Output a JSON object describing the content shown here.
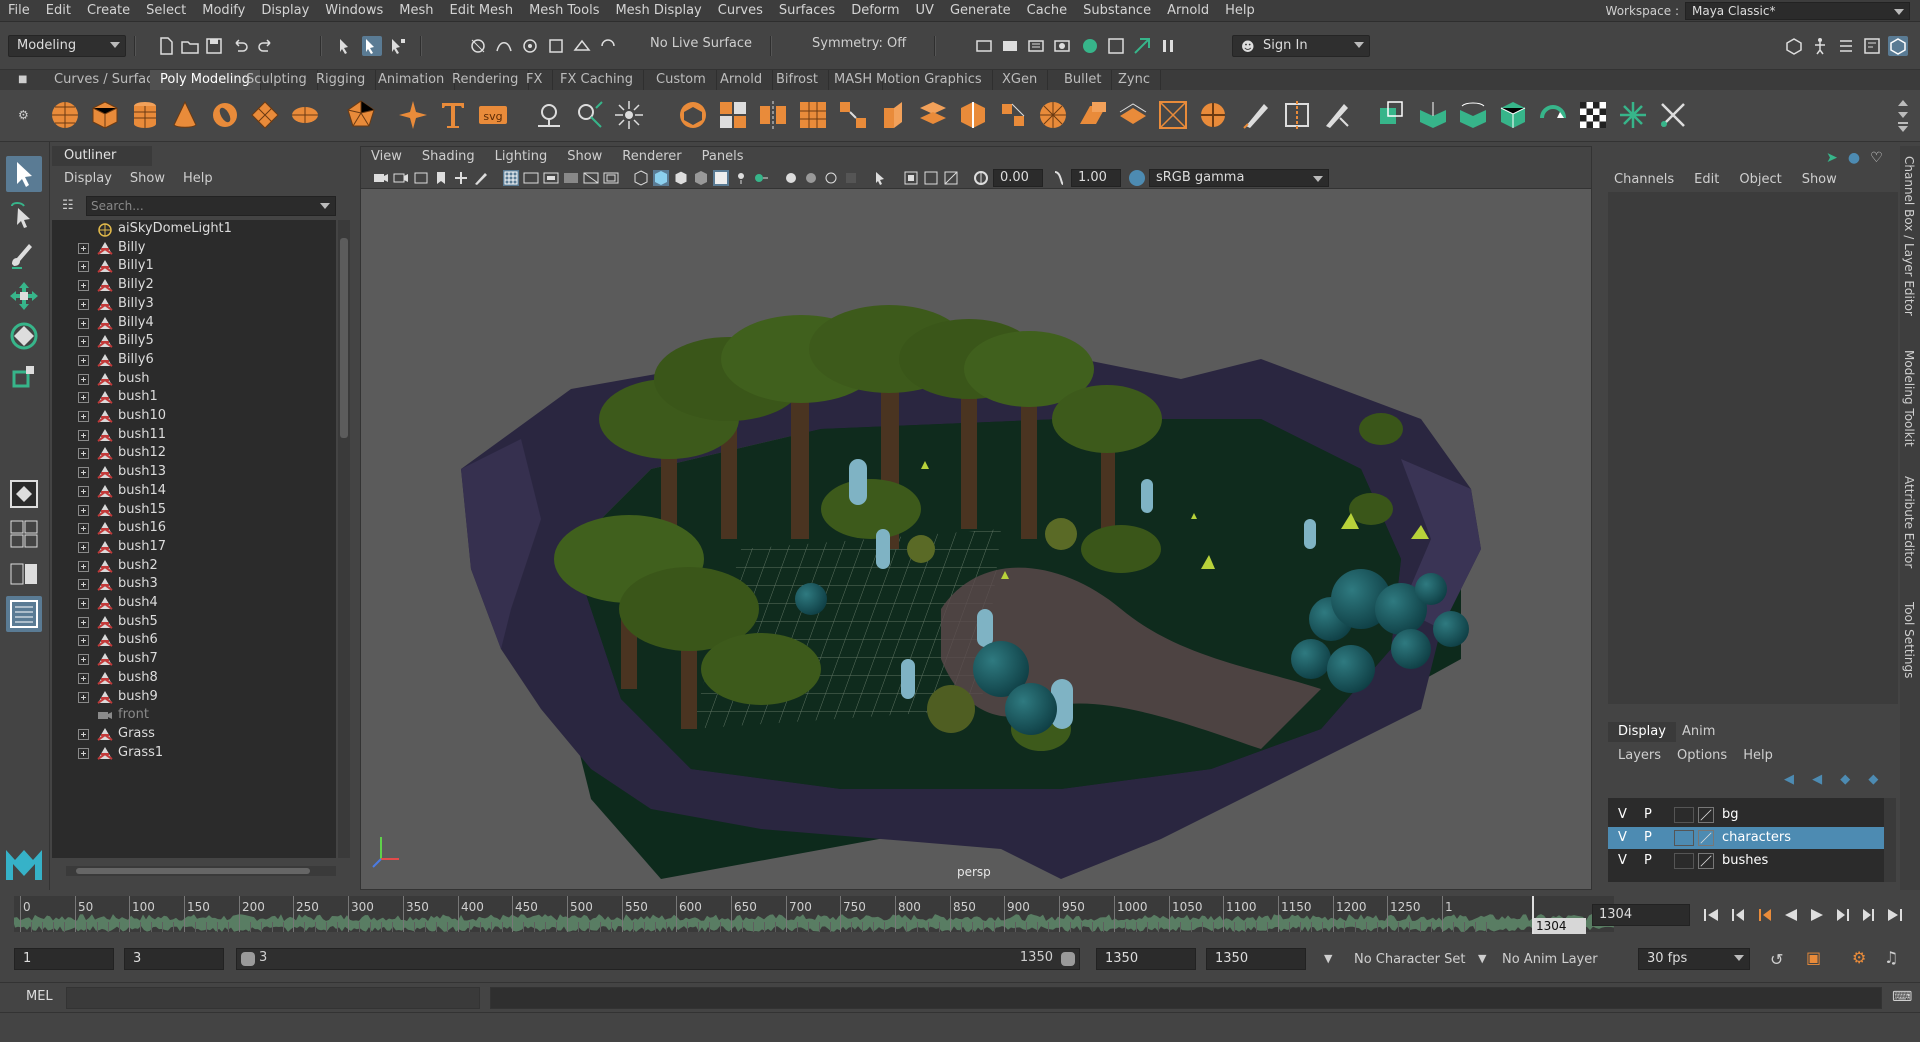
{
  "menubar": {
    "items": [
      "File",
      "Edit",
      "Create",
      "Select",
      "Modify",
      "Display",
      "Windows",
      "Mesh",
      "Edit Mesh",
      "Mesh Tools",
      "Mesh Display",
      "Curves",
      "Surfaces",
      "Deform",
      "UV",
      "Generate",
      "Cache",
      "Substance",
      "Arnold",
      "Help"
    ],
    "workspace_label": "Workspace :",
    "workspace_value": "Maya Classic*"
  },
  "statusline": {
    "mode": "Modeling",
    "live_surface": "No Live Surface",
    "symmetry": "Symmetry: Off",
    "sign_in": "Sign In"
  },
  "shelf": {
    "tabs": [
      "Curves / Surfaces",
      "Poly Modeling",
      "Sculpting",
      "Rigging",
      "Animation",
      "Rendering",
      "FX",
      "FX Caching",
      "Custom",
      "Arnold",
      "Bifrost",
      "MASH",
      "Motion Graphics",
      "XGen",
      "Bullet",
      "Zync"
    ],
    "active_tab": "Poly Modeling",
    "svg_label": "svg"
  },
  "outliner": {
    "title": "Outliner",
    "menu": [
      "Display",
      "Show",
      "Help"
    ],
    "search_placeholder": "Search...",
    "items": [
      {
        "label": "aiSkyDomeLight1",
        "type": "light",
        "expandable": false
      },
      {
        "label": "Billy",
        "type": "mesh",
        "expandable": true
      },
      {
        "label": "Billy1",
        "type": "mesh",
        "expandable": true
      },
      {
        "label": "Billy2",
        "type": "mesh",
        "expandable": true
      },
      {
        "label": "Billy3",
        "type": "mesh",
        "expandable": true
      },
      {
        "label": "Billy4",
        "type": "mesh",
        "expandable": true
      },
      {
        "label": "Billy5",
        "type": "mesh",
        "expandable": true
      },
      {
        "label": "Billy6",
        "type": "mesh",
        "expandable": true
      },
      {
        "label": "bush",
        "type": "mesh",
        "expandable": true
      },
      {
        "label": "bush1",
        "type": "mesh",
        "expandable": true
      },
      {
        "label": "bush10",
        "type": "mesh",
        "expandable": true
      },
      {
        "label": "bush11",
        "type": "mesh",
        "expandable": true
      },
      {
        "label": "bush12",
        "type": "mesh",
        "expandable": true
      },
      {
        "label": "bush13",
        "type": "mesh",
        "expandable": true
      },
      {
        "label": "bush14",
        "type": "mesh",
        "expandable": true
      },
      {
        "label": "bush15",
        "type": "mesh",
        "expandable": true
      },
      {
        "label": "bush16",
        "type": "mesh",
        "expandable": true
      },
      {
        "label": "bush17",
        "type": "mesh",
        "expandable": true
      },
      {
        "label": "bush2",
        "type": "mesh",
        "expandable": true
      },
      {
        "label": "bush3",
        "type": "mesh",
        "expandable": true
      },
      {
        "label": "bush4",
        "type": "mesh",
        "expandable": true
      },
      {
        "label": "bush5",
        "type": "mesh",
        "expandable": true
      },
      {
        "label": "bush6",
        "type": "mesh",
        "expandable": true
      },
      {
        "label": "bush7",
        "type": "mesh",
        "expandable": true
      },
      {
        "label": "bush8",
        "type": "mesh",
        "expandable": true
      },
      {
        "label": "bush9",
        "type": "mesh",
        "expandable": true
      },
      {
        "label": "front",
        "type": "camera",
        "expandable": false,
        "dim": true
      },
      {
        "label": "Grass",
        "type": "mesh",
        "expandable": true
      },
      {
        "label": "Grass1",
        "type": "mesh",
        "expandable": true
      }
    ]
  },
  "viewport": {
    "menu": [
      "View",
      "Shading",
      "Lighting",
      "Show",
      "Renderer",
      "Panels"
    ],
    "exposure": "0.00",
    "gamma": "1.00",
    "color_space": "sRGB gamma",
    "camera": "persp"
  },
  "channelbox": {
    "menu": [
      "Channels",
      "Edit",
      "Object",
      "Show"
    ],
    "layer_tabs": [
      "Display",
      "Anim"
    ],
    "layer_menu": [
      "Layers",
      "Options",
      "Help"
    ],
    "layers": [
      {
        "v": "V",
        "p": "P",
        "name": "bg",
        "selected": false
      },
      {
        "v": "V",
        "p": "P",
        "name": "characters",
        "selected": true
      },
      {
        "v": "V",
        "p": "P",
        "name": "bushes",
        "selected": false
      }
    ]
  },
  "side_tabs": [
    "Channel Box / Layer Editor",
    "Modeling Toolkit",
    "Attribute Editor",
    "Tool Settings"
  ],
  "timeline": {
    "ticks": [
      "0",
      "50",
      "100",
      "150",
      "200",
      "250",
      "300",
      "350",
      "400",
      "450",
      "500",
      "550",
      "600",
      "650",
      "700",
      "750",
      "800",
      "850",
      "900",
      "950",
      "1000",
      "1050",
      "1100",
      "1150",
      "1200",
      "1250",
      "1"
    ],
    "current_frame": "1304",
    "frame_field": "1304"
  },
  "range": {
    "start": "1",
    "range_start": "3",
    "slider_start": "3",
    "slider_end": "1350",
    "range_end": "1350",
    "end": "1350",
    "character_set": "No Character Set",
    "anim_layer": "No Anim Layer",
    "fps": "30 fps"
  },
  "cmdline": {
    "label": "MEL"
  },
  "colors": {
    "accent_orange": "#e98b3a",
    "selection_blue": "#4d8bb2",
    "shelf_green": "#37b58a"
  }
}
